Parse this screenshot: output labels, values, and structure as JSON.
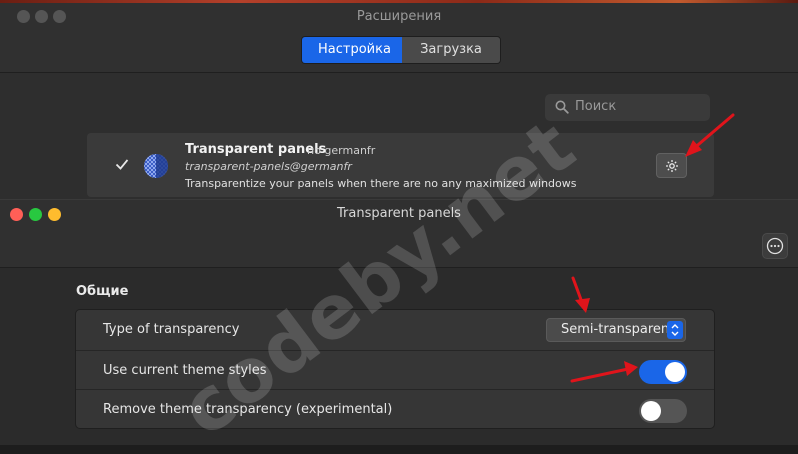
{
  "extensions_window": {
    "title": "Расширения",
    "tabs": [
      {
        "label": "Настройка",
        "active": true
      },
      {
        "label": "Загрузка",
        "active": false
      }
    ],
    "search": {
      "placeholder": "Поиск"
    },
    "extension": {
      "name": "Transparent panels",
      "author": "по germanfr",
      "uuid": "transparent-panels@germanfr",
      "description": "Transparentize your panels when there are no any maximized windows",
      "enabled": true
    }
  },
  "settings_window": {
    "title": "Transparent panels",
    "section_title": "Общие",
    "rows": [
      {
        "label": "Type of transparency",
        "value": "Semi-transparent"
      },
      {
        "label": "Use current theme styles",
        "toggle_on": true
      },
      {
        "label": "Remove theme transparency (experimental)",
        "toggle_on": false
      }
    ]
  },
  "watermark": "codeby.net",
  "colors": {
    "accent": "#1a66e8",
    "annotation_arrow": "#e0141b",
    "close": "#ff5f57",
    "minimize": "#febc2e",
    "maximize": "#28c840"
  }
}
